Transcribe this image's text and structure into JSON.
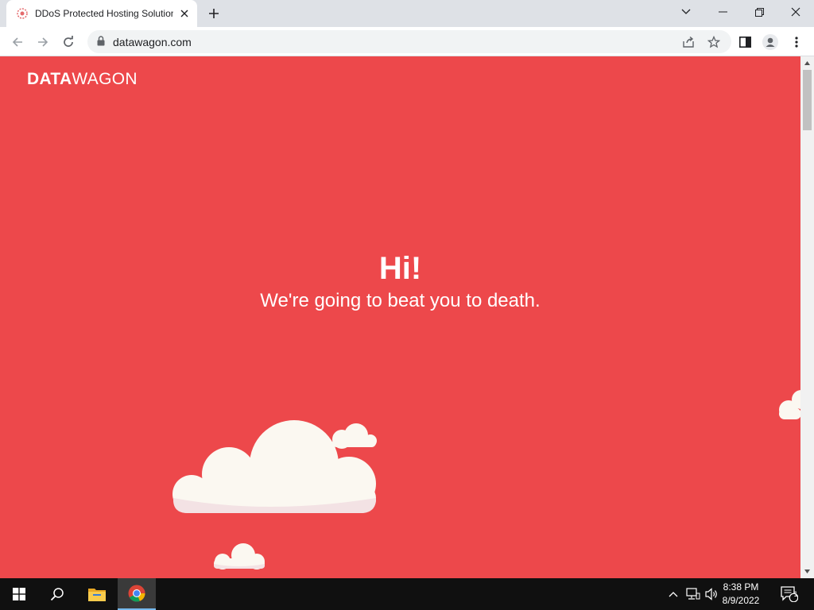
{
  "browser": {
    "tab": {
      "title": "DDoS Protected Hosting Solutions",
      "favicon": "datawagon-favicon-icon"
    },
    "url": "datawagon.com",
    "window_controls": [
      "tab-search-icon",
      "minimize-icon",
      "restore-icon",
      "close-icon"
    ],
    "toolbar_icons": [
      "back-icon",
      "forward-icon",
      "reload-icon",
      "lock-icon",
      "share-icon",
      "star-icon",
      "side-panel-icon",
      "profile-icon",
      "menu-icon"
    ]
  },
  "page": {
    "logo": {
      "bold": "DATA",
      "light": "WAGON"
    },
    "hero": {
      "title": "Hi!",
      "subtitle": "We're going to beat you to death."
    },
    "colors": {
      "background": "#ed484b",
      "cloud": "#fbf8f1",
      "cloud_shadow": "#f3e2e4"
    }
  },
  "taskbar": {
    "time": "8:38 PM",
    "date": "8/9/2022",
    "notification_count": "1",
    "apps": [
      "windows-start-icon",
      "search-icon",
      "file-explorer-icon",
      "chrome-icon"
    ],
    "tray_icons": [
      "chevron-up-icon",
      "network-icon",
      "volume-icon",
      "notification-icon"
    ]
  }
}
